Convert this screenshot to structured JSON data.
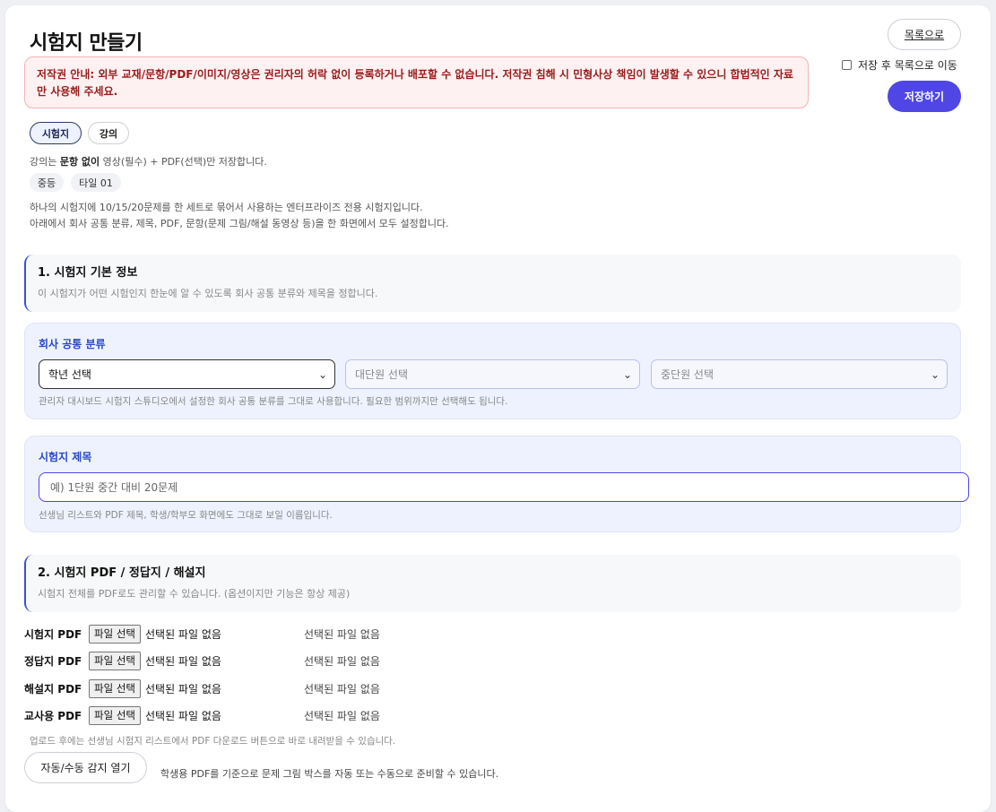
{
  "header": {
    "title": "시험지 만들기",
    "list_button": "목록으로",
    "save_after_label": "저장 후 목록으로 이동",
    "save_button": "저장하기"
  },
  "notice": "저작권 안내: 외부 교재/문항/PDF/이미지/영상은 권리자의 허락 없이 등록하거나 배포할 수 없습니다. 저작권 침해 시 민형사상 책임이 발생할 수 있으니 합법적인 자료만 사용해 주세요.",
  "type_tabs": [
    {
      "label": "시험지",
      "active": true
    },
    {
      "label": "강의",
      "active": false
    }
  ],
  "lecture_note": {
    "pre": "강의는 ",
    "bold": "문항 없이",
    "post": " 영상(필수) + PDF(선택)만 저장합니다."
  },
  "chips": [
    "중등",
    "타일 01"
  ],
  "intro_lines": [
    "하나의 시험지에 10/15/20문제를 한 세트로 묶어서 사용하는 엔터프라이즈 전용 시험지입니다.",
    "아래에서 회사 공통 분류, 제목, PDF, 문항(문제 그림/해설 동영상 등)을 한 화면에서 모두 설정합니다."
  ],
  "section1": {
    "title": "1. 시험지 기본 정보",
    "subtitle": "이 시험지가 어떤 시험인지 한눈에 알 수 있도록 회사 공통 분류와 제목을 정합니다."
  },
  "category": {
    "title": "회사 공통 분류",
    "grade": "학년 선택",
    "unit_major": "대단원 선택",
    "unit_middle": "중단원 선택",
    "note": "관리자 대시보드 시험지 스튜디오에서 설정한 회사 공통 분류를 그대로 사용합니다. 필요한 범위까지만 선택해도 됩니다."
  },
  "exam_title": {
    "title": "시험지 제목",
    "placeholder": "예) 1단원 중간 대비 20문제",
    "note": "선생님 리스트와 PDF 제목, 학생/학부모 화면에도 그대로 보일 이름입니다."
  },
  "section2": {
    "title": "2. 시험지 PDF / 정답지 / 해설지",
    "subtitle": "시험지 전체를 PDF로도 관리할 수 있습니다. (옵션이지만 기능은 항상 제공)"
  },
  "pdf_rows": [
    {
      "label": "시험지 PDF",
      "button": "파일 선택",
      "file": "선택된 파일 없음",
      "status": "선택된 파일 없음"
    },
    {
      "label": "정답지 PDF",
      "button": "파일 선택",
      "file": "선택된 파일 없음",
      "status": "선택된 파일 없음"
    },
    {
      "label": "해설지 PDF",
      "button": "파일 선택",
      "file": "선택된 파일 없음",
      "status": "선택된 파일 없음"
    },
    {
      "label": "교사용 PDF",
      "button": "파일 선택",
      "file": "선택된 파일 없음",
      "status": "선택된 파일 없음"
    }
  ],
  "upload_note": "업로드 후에는 선생님 시험지 리스트에서 PDF 다운로드 버튼으로 바로 내려받을 수 있습니다.",
  "detect": {
    "button": "자동/수동 감지 열기",
    "note": "학생용 PDF를 기준으로 문제 그림 박스를 자동 또는 수동으로 준비할 수 있습니다."
  }
}
